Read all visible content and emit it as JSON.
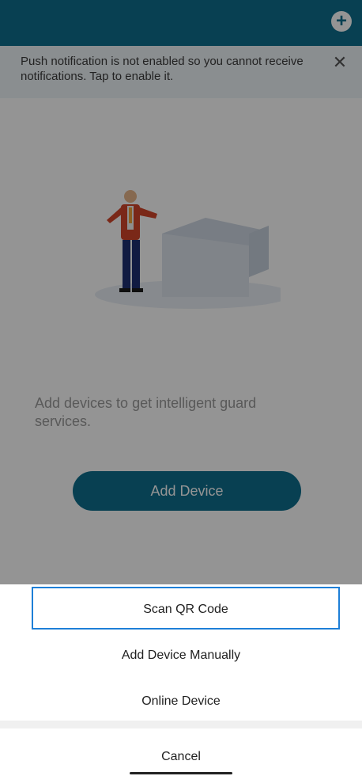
{
  "topbar": {
    "add_icon": "plus-circle-icon"
  },
  "notification": {
    "text": "Push notification is not enabled so you cannot receive notifications. Tap to enable it.",
    "close_icon": "close-icon"
  },
  "empty_state": {
    "message": "Add devices to get intelligent guard services.",
    "button_label": "Add Device"
  },
  "action_sheet": {
    "items": [
      {
        "label": "Scan QR Code"
      },
      {
        "label": "Add Device Manually"
      },
      {
        "label": "Online Device"
      }
    ],
    "cancel_label": "Cancel"
  },
  "colors": {
    "brand": "#0f6f8d",
    "focus": "#1e7fd7"
  }
}
